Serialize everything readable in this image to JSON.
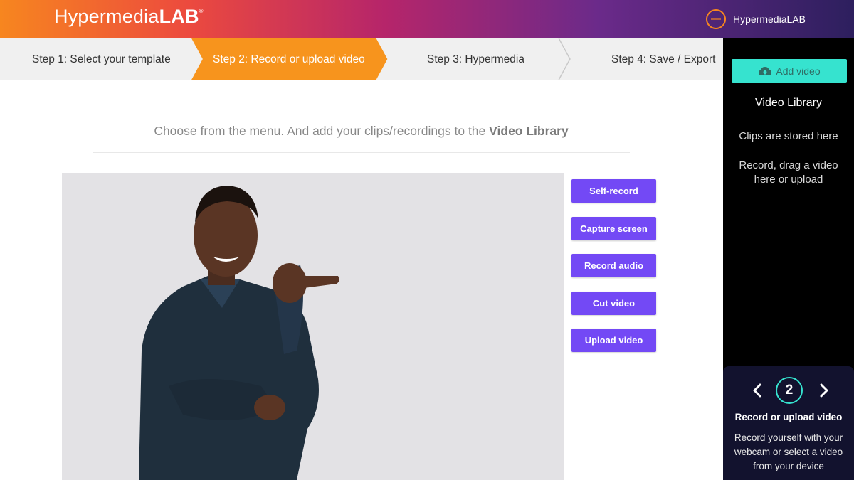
{
  "header": {
    "logo_text": "Hypermedia",
    "logo_lab": "LAB",
    "logo_reg": "®",
    "account_name": "HypermediaLAB",
    "account_icon": "account-circle-icon"
  },
  "steps": [
    {
      "label": "Step 1: Select your template",
      "active": false
    },
    {
      "label": "Step 2: Record or upload video",
      "active": true
    },
    {
      "label": "Step 3: Hypermedia",
      "active": false
    },
    {
      "label": "Step 4: Save / Export",
      "active": false
    }
  ],
  "main": {
    "instruction": "Choose from the menu. And add your clips/recordings to the",
    "instruction_bold": "Video Library"
  },
  "actions": [
    {
      "label": "Self-record"
    },
    {
      "label": "Capture screen"
    },
    {
      "label": "Record audio"
    },
    {
      "label": "Cut video"
    },
    {
      "label": "Upload video"
    }
  ],
  "sidebar": {
    "add_video_label": "Add video",
    "add_video_icon": "cloud-upload-icon",
    "library_title": "Video Library",
    "library_hint_1": "Clips are stored here",
    "library_hint_2": "Record, drag a video here or upload"
  },
  "step_panel": {
    "step_number": "2",
    "title": "Record or upload video",
    "description": "Record yourself with your webcam or select a video from your device"
  },
  "colors": {
    "accent_orange": "#f7861f",
    "accent_purple": "#7349f5",
    "accent_teal": "#36e3cf"
  }
}
